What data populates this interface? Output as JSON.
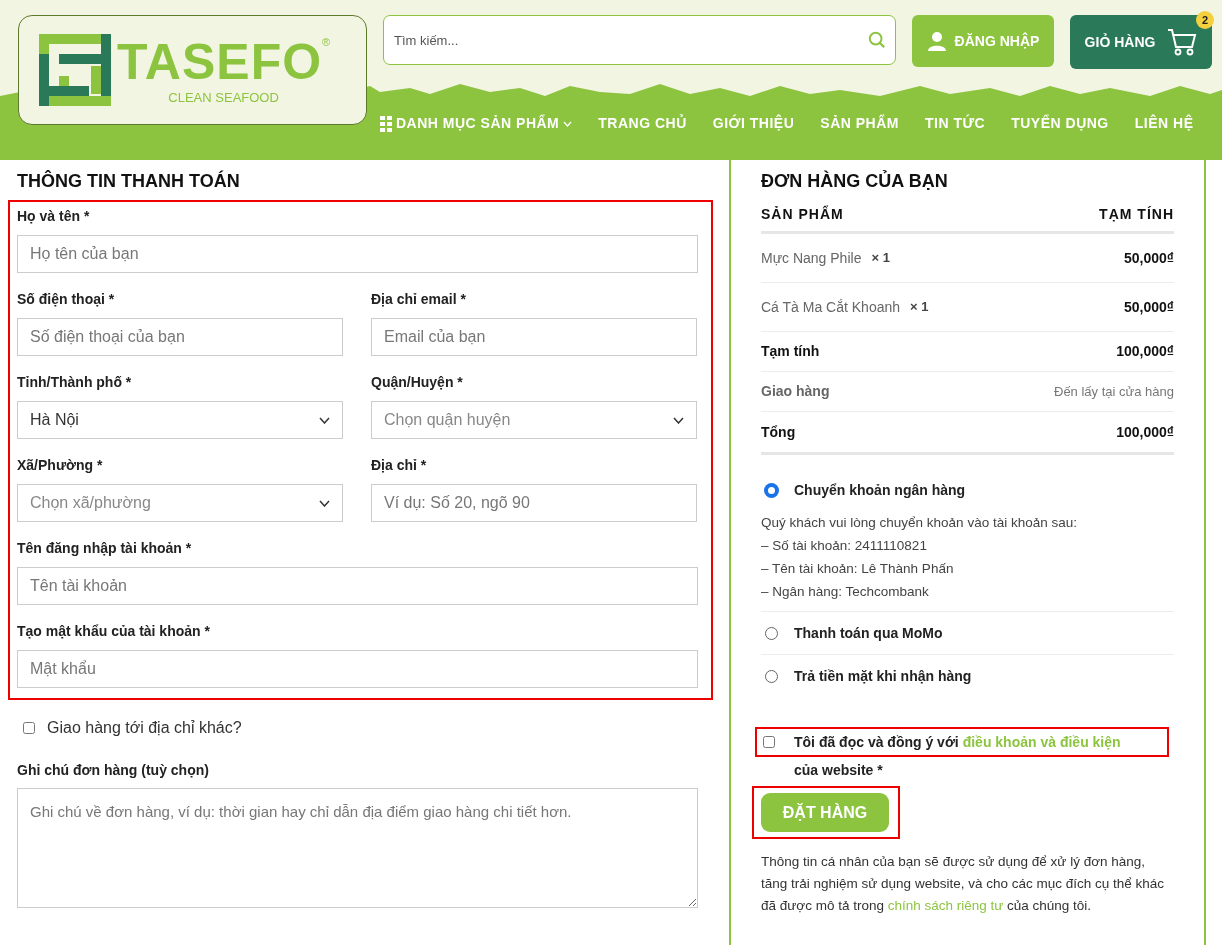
{
  "header": {
    "logo": {
      "name": "TASEFO",
      "mark": "®",
      "tagline": "CLEAN SEAFOOD"
    },
    "search": {
      "placeholder": "Tìm kiếm..."
    },
    "login_button": "ĐĂNG NHẬP",
    "cart": {
      "label": "GIỎ HÀNG",
      "count": "2"
    },
    "nav": [
      {
        "label": "DANH MỤC SẢN PHẨM",
        "kind": "menu"
      },
      {
        "label": "TRANG CHỦ",
        "kind": "link"
      },
      {
        "label": "GIỚI THIỆU",
        "kind": "link"
      },
      {
        "label": "SẢN PHẨM",
        "kind": "link"
      },
      {
        "label": "TIN TỨC",
        "kind": "link"
      },
      {
        "label": "TUYỂN DỤNG",
        "kind": "link"
      },
      {
        "label": "LIÊN HỆ",
        "kind": "link"
      }
    ]
  },
  "billing": {
    "title": "THÔNG TIN THANH TOÁN",
    "rows": [
      [
        {
          "kind": "text",
          "label": "Họ và tên *",
          "placeholder": "Họ tên của bạn"
        }
      ],
      [
        {
          "kind": "text",
          "label": "Số điện thoại *",
          "placeholder": "Số điện thoại của bạn"
        },
        {
          "kind": "text",
          "label": "Địa chỉ email *",
          "placeholder": "Email của bạn"
        }
      ],
      [
        {
          "kind": "select",
          "label": "Tỉnh/Thành phố *",
          "value": "Hà Nội"
        },
        {
          "kind": "select",
          "label": "Quận/Huyện *",
          "placeholder": "Chọn quận huyện"
        }
      ],
      [
        {
          "kind": "select",
          "label": "Xã/Phường *",
          "placeholder": "Chọn xã/phường"
        },
        {
          "kind": "text",
          "label": "Địa chỉ *",
          "placeholder": "Ví dụ: Số 20, ngõ 90"
        }
      ],
      [
        {
          "kind": "text",
          "label": "Tên đăng nhập tài khoản *",
          "placeholder": "Tên tài khoản"
        }
      ],
      [
        {
          "kind": "text",
          "label": "Tạo mật khẩu của tài khoản *",
          "placeholder": "Mật khẩu"
        }
      ]
    ],
    "ship_elsewhere": {
      "label": "Giao hàng tới địa chỉ khác?",
      "checked": false
    },
    "notes": {
      "label": "Ghi chú đơn hàng (tuỳ chọn)",
      "placeholder": "Ghi chú về đơn hàng, ví dụ: thời gian hay chỉ dẫn địa điểm giao hàng chi tiết hơn."
    }
  },
  "order": {
    "title": "ĐƠN HÀNG CỦA BẠN",
    "columns": [
      "SẢN PHẨM",
      "TẠM TÍNH"
    ],
    "items": [
      {
        "name": "Mực Nang Phile",
        "qty": "× 1",
        "price": "50,000₫"
      },
      {
        "name": "Cá Tà Ma Cắt Khoanh",
        "qty": "× 1",
        "price": "50,000₫"
      }
    ],
    "summary": [
      {
        "kind": "subtotal",
        "label": "Tạm tính",
        "value": "100,000₫"
      },
      {
        "kind": "shipping",
        "label": "Giao hàng",
        "value": "Đến lấy tại cửa hàng"
      },
      {
        "kind": "total",
        "label": "Tổng",
        "value": "100,000₫"
      }
    ],
    "payment_methods": [
      {
        "label": "Chuyển khoản ngân hàng",
        "selected": true,
        "details": [
          "Quý khách vui lòng chuyển khoản vào tài khoản sau:",
          "– Số tài khoản: 2411110821",
          "– Tên tài khoản: Lê Thành Phấn",
          "– Ngân hàng: Techcombank"
        ]
      },
      {
        "label": "Thanh toán qua MoMo",
        "selected": false
      },
      {
        "label": "Trả tiền mặt khi nhận hàng",
        "selected": false
      }
    ],
    "terms": {
      "checked": false,
      "before": "Tôi đã đọc và đồng ý với ",
      "link": "điều khoản và điều kiện",
      "after": " của website",
      "required": "*"
    },
    "place_order": "ĐẶT HÀNG",
    "privacy": {
      "before": "Thông tin cá nhân của bạn sẽ được sử dụng để xử lý đơn hàng, tăng trải nghiệm sử dụng website, và cho các mục đích cụ thể khác đã được mô tả trong ",
      "link": "chính sách riêng tư",
      "after": " của chúng tôi."
    }
  }
}
